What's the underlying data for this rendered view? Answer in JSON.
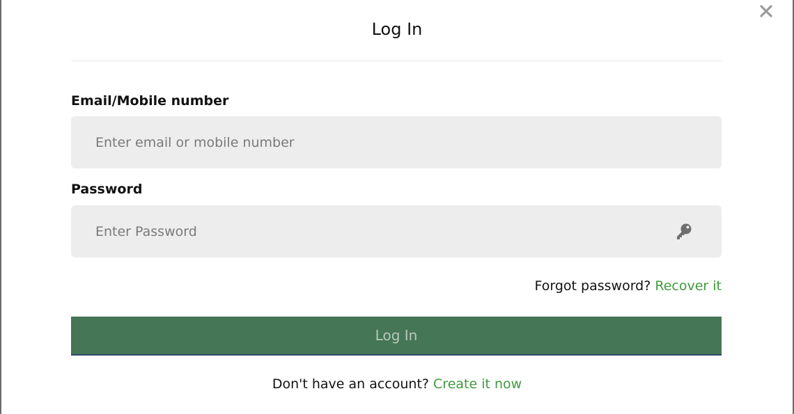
{
  "dialog": {
    "title": "Log In",
    "close_icon": "close-icon"
  },
  "email": {
    "label": "Email/Mobile number",
    "placeholder": "Enter email or mobile number",
    "value": ""
  },
  "password": {
    "label": "Password",
    "placeholder": "Enter Password",
    "value": "",
    "icon": "key-icon"
  },
  "forgot": {
    "text": "Forgot password?",
    "link": "Recover it"
  },
  "submit": {
    "label": "Log In"
  },
  "signup": {
    "text": "Don't have an account?",
    "link": "Create it now"
  },
  "colors": {
    "primary_button": "#457656",
    "link": "#3f9a3f",
    "field_background": "#ededed"
  }
}
